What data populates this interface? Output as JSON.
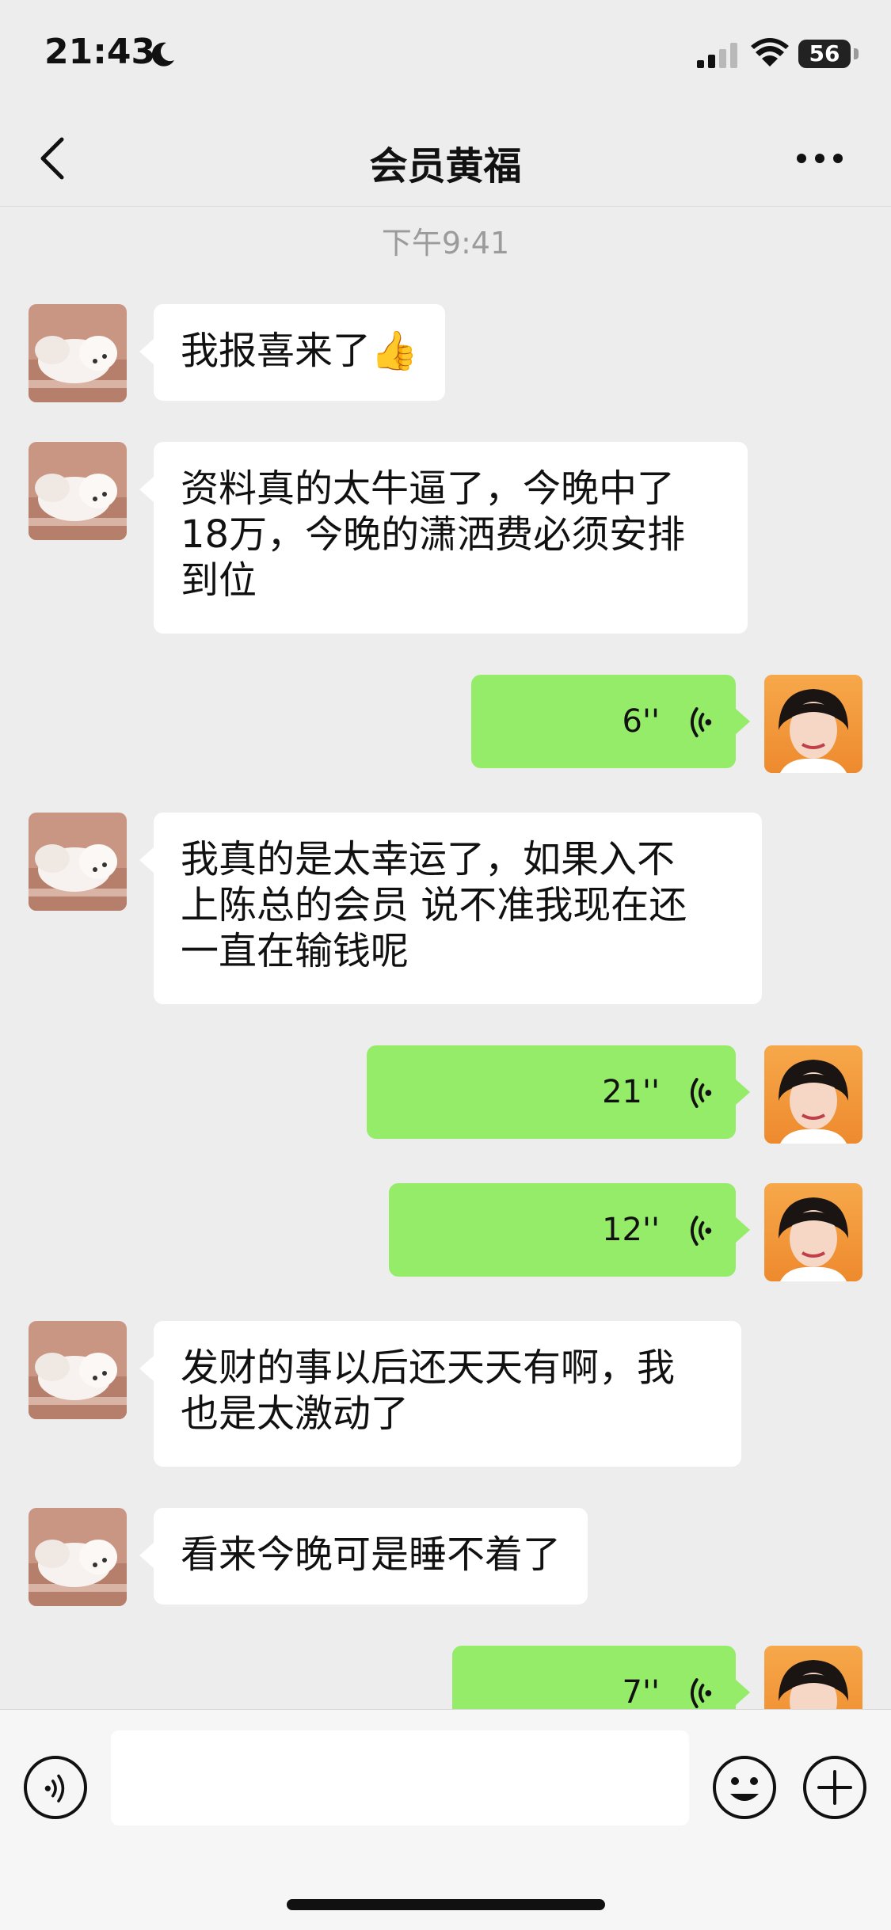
{
  "status_bar": {
    "time": "21:43",
    "battery": "56"
  },
  "header": {
    "title": "会员黄福"
  },
  "chat": {
    "timestamp": "下午9:41",
    "messages": [
      {
        "sender": "contact",
        "type": "text",
        "text": "我报喜来了👍"
      },
      {
        "sender": "contact",
        "type": "text",
        "lines": [
          "资料真的太牛逼了，今晚中了",
          "18万，今晚的潇洒费必须安排",
          "到位"
        ]
      },
      {
        "sender": "me",
        "type": "voice",
        "duration": "6''"
      },
      {
        "sender": "contact",
        "type": "text",
        "lines": [
          "我真的是太幸运了，如果入不",
          "上陈总的会员  说不准我现在还",
          "一直在输钱呢"
        ]
      },
      {
        "sender": "me",
        "type": "voice",
        "duration": "21''"
      },
      {
        "sender": "me",
        "type": "voice",
        "duration": "12''"
      },
      {
        "sender": "contact",
        "type": "text",
        "lines": [
          "发财的事以后还天天有啊，我",
          "也是太激动了"
        ]
      },
      {
        "sender": "contact",
        "type": "text",
        "text": "看来今晚可是睡不着了"
      },
      {
        "sender": "me",
        "type": "voice",
        "duration": "7''"
      }
    ]
  },
  "input_bar": {
    "placeholder": ""
  },
  "colors": {
    "outgoing_bubble": "#95ec69",
    "incoming_bubble": "#ffffff",
    "background": "#ededed"
  },
  "icons": [
    "moon-icon",
    "signal-icon",
    "wifi-icon",
    "back-chevron-icon",
    "more-dots-icon",
    "voice-wave-icon",
    "voice-mode-icon",
    "emoji-icon",
    "plus-icon"
  ]
}
